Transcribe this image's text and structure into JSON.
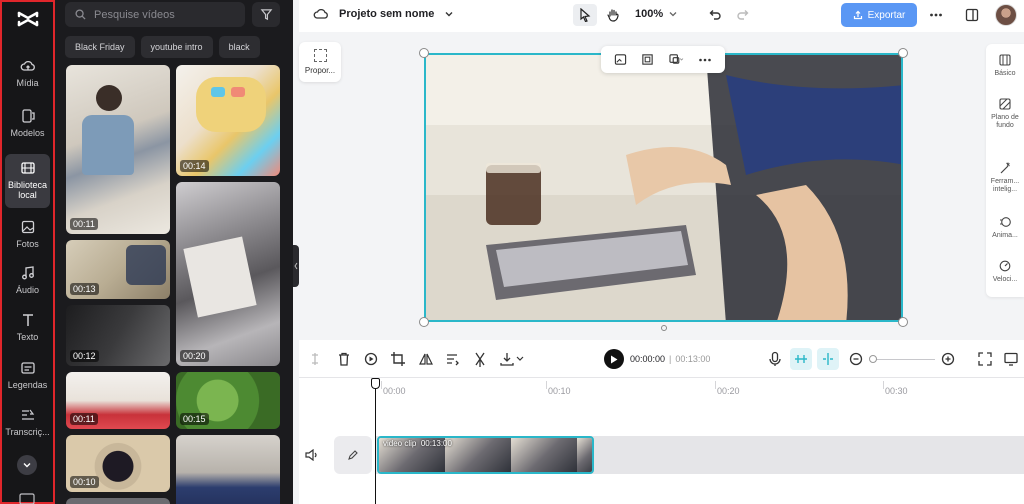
{
  "rail": {
    "items": [
      {
        "label": "Mídia",
        "icon": "cloud-upload-icon"
      },
      {
        "label": "Modelos",
        "icon": "template-icon"
      },
      {
        "label": "Biblioteca local",
        "icon": "film-strip-icon",
        "active": true
      },
      {
        "label": "Fotos",
        "icon": "image-icon"
      },
      {
        "label": "Áudio",
        "icon": "music-note-icon"
      },
      {
        "label": "Texto",
        "icon": "text-icon"
      },
      {
        "label": "Legendas",
        "icon": "captions-icon"
      },
      {
        "label": "Transcriç...",
        "icon": "transcript-icon"
      }
    ]
  },
  "panel": {
    "search_placeholder": "Pesquise vídeos",
    "chips": [
      "Black Friday",
      "youtube intro",
      "black"
    ],
    "thumbs": [
      "00:11",
      "00:14",
      "00:13",
      "00:20",
      "00:12",
      "00:11",
      "00:15",
      "00:10"
    ]
  },
  "topbar": {
    "project_name": "Projeto sem nome",
    "zoom": "100%",
    "export_label": "Exportar"
  },
  "canvas": {
    "ratio_label": "Propor..."
  },
  "right_panel": {
    "items": [
      "Básico",
      "Plano de fundo",
      "Ferram... intelig...",
      "Anima...",
      "Veloci..."
    ]
  },
  "timeline": {
    "current_time": "00:00:00",
    "total_time": "00:13:00",
    "ticks": [
      "00:00",
      "00:10",
      "00:20",
      "00:30"
    ],
    "clip_name": "video clip",
    "clip_duration": "00:13:00"
  },
  "colors": {
    "accent": "#2ab7c9",
    "export": "#5a97f4",
    "rail_border": "#e0262b"
  }
}
